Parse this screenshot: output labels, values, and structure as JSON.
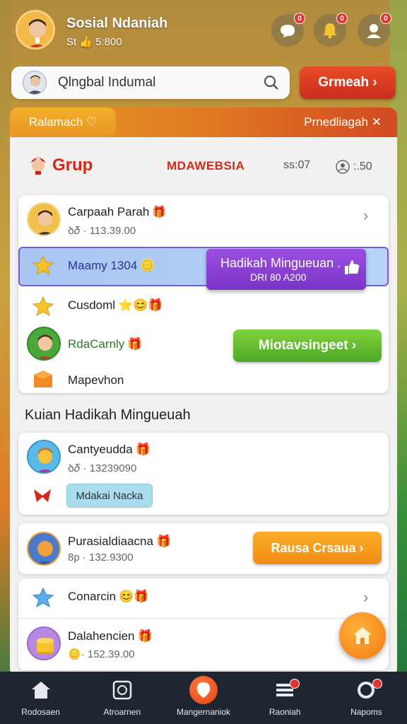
{
  "header": {
    "user_name": "Sosial Ndaniah",
    "user_sub": "St 👍 5:800",
    "badges": [
      "0",
      "0",
      "0"
    ]
  },
  "search": {
    "placeholder": "Qlngbal Indumal",
    "button_label": "Grmeah ›"
  },
  "tabs": {
    "left": "Ralamach ♡",
    "right": "Prnedliagah ✕"
  },
  "group": {
    "title": "Grup",
    "country": "MDAWEBSIA",
    "time": "ss:07",
    "count": ":.50"
  },
  "rows": [
    {
      "name": "Carpaah Parah",
      "sub": "ꝺ𝛿 · 113.39.00"
    },
    {
      "name": "Maamy 1304",
      "sub": ""
    },
    {
      "name": "Cusdoml",
      "sub": ""
    },
    {
      "name": "RdaCarnly",
      "sub": ""
    },
    {
      "name": "Mapevhon",
      "sub": ""
    }
  ],
  "popup": {
    "title": "Hadikah Mingueuan .",
    "sub": "DRI 80 A200"
  },
  "green_button": "Miotavsingeet ›",
  "section_title": "Kuian Hadikah Mingueuah",
  "rows2": [
    {
      "name": "Cantyeudda",
      "sub": "ꝺ𝛿 · 13239090"
    },
    {
      "name": "Purasialdiaacna",
      "sub": "8p · 132.9300"
    },
    {
      "name": "Conarcin",
      "sub": ""
    },
    {
      "name": "Dalahencien",
      "sub": "· 152.39.00"
    }
  ],
  "pill_label": "Mdakai Nacka",
  "orange_button": "Rausa Crsaua ›",
  "nav": [
    {
      "label": "Rodosaen"
    },
    {
      "label": "Atroarnen"
    },
    {
      "label": "Mangernaniok"
    },
    {
      "label": "Raoniah"
    },
    {
      "label": "Napoms"
    }
  ],
  "colors": {
    "accent_red": "#d7261a",
    "green": "#4ea828",
    "orange": "#f28c16",
    "purple": "#7a35c6"
  }
}
